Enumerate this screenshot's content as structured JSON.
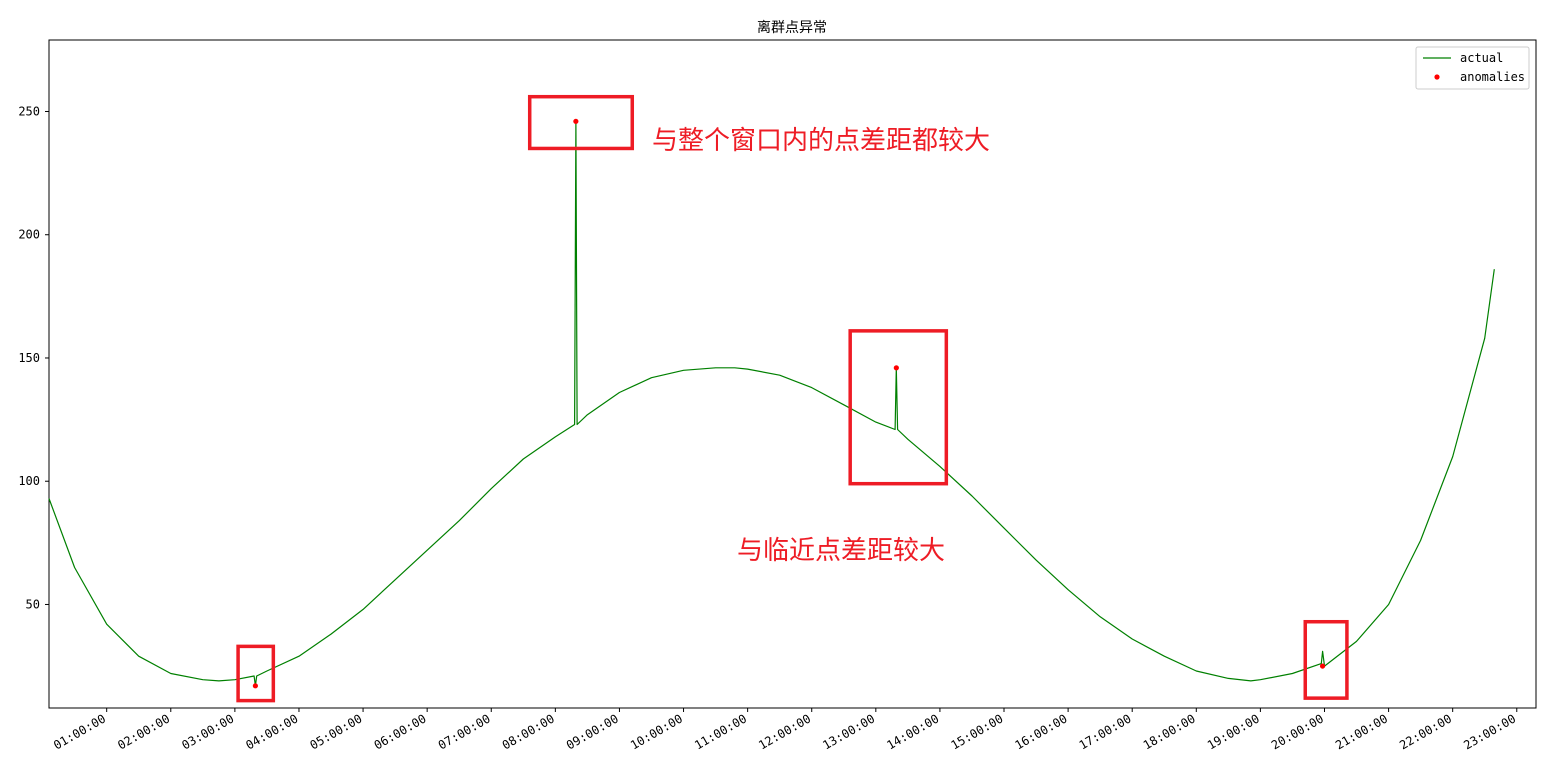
{
  "chart_data": {
    "type": "line",
    "title": "离群点异常",
    "xlabel": "",
    "ylabel": "",
    "x_unit": "hour",
    "xlim": [
      0.1,
      23.3
    ],
    "ylim": [
      8,
      279
    ],
    "yticks": [
      50,
      100,
      150,
      200,
      250
    ],
    "xticks": [
      1,
      2,
      3,
      4,
      5,
      6,
      7,
      8,
      9,
      10,
      11,
      12,
      13,
      14,
      15,
      16,
      17,
      18,
      19,
      20,
      21,
      22,
      23
    ],
    "xtick_labels": [
      "01:00:00",
      "02:00:00",
      "03:00:00",
      "04:00:00",
      "05:00:00",
      "06:00:00",
      "07:00:00",
      "08:00:00",
      "09:00:00",
      "10:00:00",
      "11:00:00",
      "12:00:00",
      "13:00:00",
      "14:00:00",
      "15:00:00",
      "16:00:00",
      "17:00:00",
      "18:00:00",
      "19:00:00",
      "20:00:00",
      "21:00:00",
      "22:00:00",
      "23:00:00"
    ],
    "ytick_labels": [
      "50",
      "100",
      "150",
      "200",
      "250"
    ],
    "grid": false,
    "legend_position": "top-right",
    "series": [
      {
        "name": "actual",
        "style": "line",
        "color": "#008000",
        "x": [
          0.1,
          0.5,
          1.0,
          1.5,
          2.0,
          2.5,
          2.75,
          3.0,
          3.3,
          3.32,
          3.34,
          3.5,
          4.0,
          4.5,
          5.0,
          5.5,
          6.0,
          6.5,
          7.0,
          7.5,
          8.0,
          8.3,
          8.32,
          8.34,
          8.5,
          9.0,
          9.5,
          10.0,
          10.5,
          10.8,
          11.0,
          11.5,
          12.0,
          12.5,
          13.0,
          13.3,
          13.32,
          13.34,
          13.5,
          14.0,
          14.5,
          15.0,
          15.5,
          16.0,
          16.5,
          17.0,
          17.5,
          18.0,
          18.5,
          18.85,
          19.0,
          19.5,
          19.95,
          19.97,
          20.0,
          20.5,
          21.0,
          21.5,
          22.0,
          22.5,
          22.65
        ],
        "y": [
          93,
          65,
          42,
          29,
          22,
          19.5,
          19,
          19.5,
          21,
          17,
          21,
          23,
          29,
          38,
          48,
          60,
          72,
          84,
          97,
          109,
          118,
          123,
          246,
          123,
          127,
          136,
          142,
          145,
          146,
          146,
          145.5,
          143,
          138,
          131,
          124,
          121,
          146,
          121,
          117,
          106,
          94,
          81,
          68,
          56,
          45,
          36,
          29,
          23,
          20,
          19,
          19.5,
          22,
          26,
          31,
          25,
          35,
          50,
          76,
          110,
          158,
          186
        ]
      },
      {
        "name": "anomalies",
        "style": "scatter",
        "color": "#ff0000",
        "x": [
          3.32,
          8.32,
          13.32,
          19.97
        ],
        "y": [
          17,
          246,
          146,
          25
        ]
      }
    ],
    "annotations": [
      {
        "text": "与整个窗口内的点差距都较大",
        "color": "#ee1c25"
      },
      {
        "text": "与临近点差距较大",
        "color": "#ee1c25"
      }
    ],
    "highlight_boxes": [
      {
        "label": "box-anomaly-1",
        "color": "#ee1c25",
        "x": [
          3.05,
          3.6
        ],
        "y": [
          11,
          33
        ]
      },
      {
        "label": "box-anomaly-2",
        "color": "#ee1c25",
        "x": [
          7.6,
          9.2
        ],
        "y": [
          235,
          256
        ]
      },
      {
        "label": "box-anomaly-3",
        "color": "#ee1c25",
        "x": [
          12.6,
          14.1
        ],
        "y": [
          99,
          161
        ]
      },
      {
        "label": "box-anomaly-4",
        "color": "#ee1c25",
        "x": [
          19.7,
          20.35
        ],
        "y": [
          12,
          43
        ]
      }
    ]
  }
}
